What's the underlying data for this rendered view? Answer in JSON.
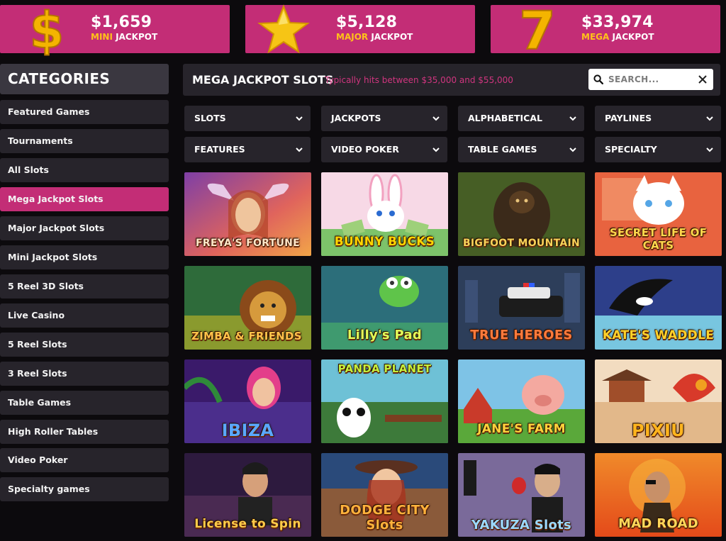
{
  "jackpots": [
    {
      "amount": "$1,659",
      "tier": "MINI",
      "suffix": " JACKPOT",
      "icon": "dollar-sign-icon"
    },
    {
      "amount": "$5,128",
      "tier": "MAJOR",
      "suffix": " JACKPOT",
      "icon": "star-icon"
    },
    {
      "amount": "$33,974",
      "tier": "MEGA",
      "suffix": " JACKPOT",
      "icon": "seven-icon"
    }
  ],
  "sidebar": {
    "header": "CATEGORIES",
    "items": [
      {
        "label": "Featured Games"
      },
      {
        "label": "Tournaments"
      },
      {
        "label": "All Slots"
      },
      {
        "label": "Mega Jackpot Slots",
        "active": true
      },
      {
        "label": "Major Jackpot Slots"
      },
      {
        "label": "Mini Jackpot Slots"
      },
      {
        "label": "5 Reel 3D Slots"
      },
      {
        "label": "Live Casino"
      },
      {
        "label": "5 Reel Slots"
      },
      {
        "label": "3 Reel Slots"
      },
      {
        "label": "Table Games"
      },
      {
        "label": "High Roller Tables"
      },
      {
        "label": "Video Poker"
      },
      {
        "label": "Specialty games"
      }
    ]
  },
  "main": {
    "title": "MEGA JACKPOT SLOTS",
    "subtitle": "Typically hits between $35,000 and $55,000",
    "search_placeholder": "SEARCH..."
  },
  "filters": [
    "SLOTS",
    "JACKPOTS",
    "ALPHABETICAL",
    "PAYLINES",
    "FEATURES",
    "VIDEO POKER",
    "TABLE GAMES",
    "SPECIALTY"
  ],
  "games": [
    {
      "title": "FREYA'S FORTUNE"
    },
    {
      "title": "BUNNY BUCKS"
    },
    {
      "title": "BIGFOOT MOUNTAIN"
    },
    {
      "title": "SECRET LIFE OF CATS"
    },
    {
      "title": "ZIMBA & FRIENDS"
    },
    {
      "title": "Lilly's Pad"
    },
    {
      "title": "TRUE HEROES"
    },
    {
      "title": "KATE'S WADDLE"
    },
    {
      "title": "IBIZA"
    },
    {
      "title": "PANDA PLANET"
    },
    {
      "title": "JANE'S FARM"
    },
    {
      "title": "PIXIU"
    },
    {
      "title": "License to Spin"
    },
    {
      "title": "DODGE CITY Slots"
    },
    {
      "title": "YAKUZA Slots"
    },
    {
      "title": "MAD ROAD"
    }
  ],
  "colors": {
    "accent": "#c32d76",
    "panel": "#27242b",
    "background": "#0c0a0d",
    "gold": "#ffc21a"
  }
}
